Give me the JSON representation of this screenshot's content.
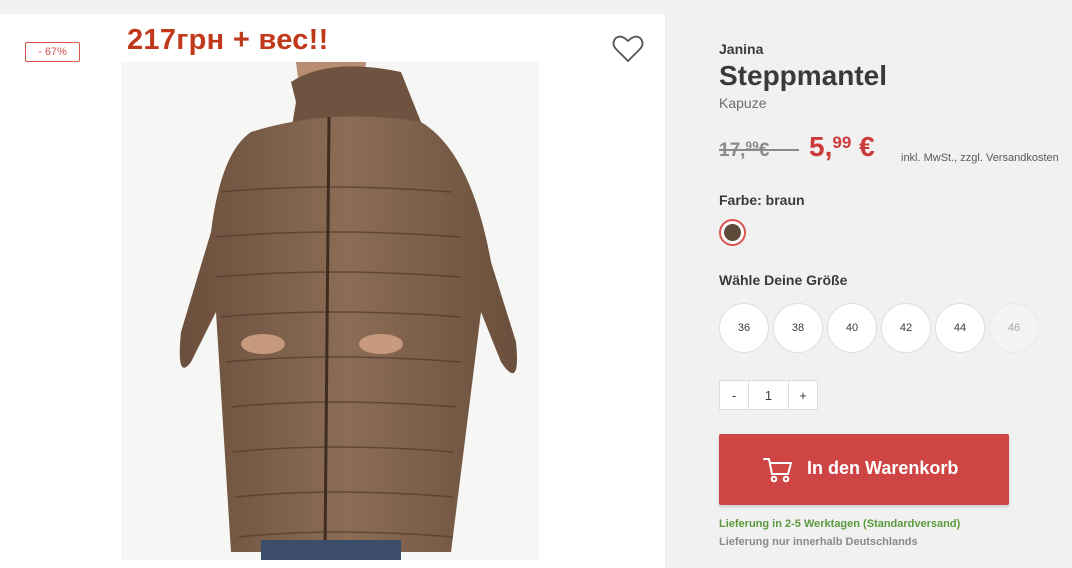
{
  "badge": {
    "discount": "- 67%"
  },
  "overlay_note": "217грн + вес!!",
  "product": {
    "brand": "Janina",
    "title": "Steppmantel",
    "subtitle": "Kapuze"
  },
  "price": {
    "old_main": "17,",
    "old_cents": "99",
    "old_currency": "€",
    "new_main": "5,",
    "new_cents": "99",
    "new_currency": "€",
    "tax_note": "inkl. MwSt., zzgl. Versandkosten"
  },
  "color": {
    "label": "Farbe: braun",
    "selected_hex": "#5e4b3a"
  },
  "sizes": {
    "label": "Wähle Deine Größe",
    "options": [
      "36",
      "38",
      "40",
      "42",
      "44",
      "46"
    ],
    "unavailable": [
      "46"
    ]
  },
  "quantity": {
    "minus": "-",
    "value": "1",
    "plus": "+"
  },
  "cart": {
    "label": "In den Warenkorb",
    "icon": "cart-icon"
  },
  "delivery": {
    "time": "Lieferung in 2-5 Werktagen (Standardversand)",
    "region": "Lieferung nur innerhalb Deutschlands"
  },
  "colors": {
    "accent": "#cf4444",
    "sale": "#cc3b3b",
    "delivery": "#5a9a3c"
  }
}
